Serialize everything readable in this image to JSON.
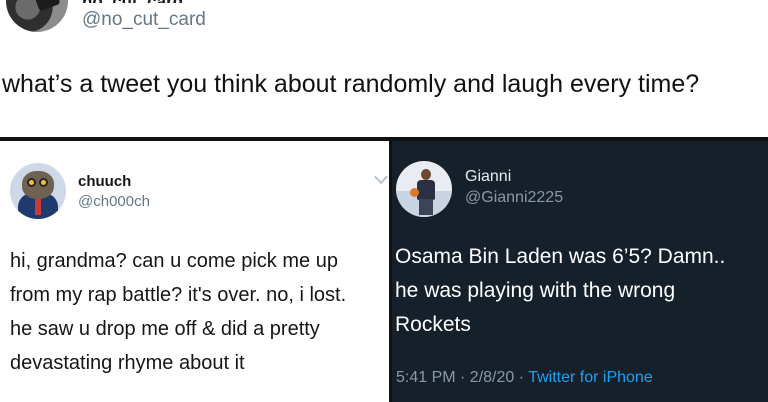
{
  "top_tweet": {
    "name": "no_cut_card",
    "handle": "@no_cut_card",
    "text": "what’s a tweet you think about randomly and laugh every time?"
  },
  "left_tweet": {
    "name": "chuuch",
    "handle": "@ch000ch",
    "lines": [
      "hi, grandma? can u come pick me up",
      "from my rap battle? it's over. no, i lost.",
      "he saw u drop me off & did a pretty",
      "devastating rhyme about it"
    ]
  },
  "right_tweet": {
    "name": "Gianni",
    "handle": "@Gianni2225",
    "lines": [
      "Osama Bin Laden was 6’5? Damn..",
      "he was playing with the wrong",
      "Rockets"
    ],
    "time": "5:41 PM · 2/8/20 · ",
    "source": "Twitter for iPhone"
  },
  "colors": {
    "dark_background": "#15202b",
    "link_blue": "#1da1f2",
    "handle_gray": "#657786"
  },
  "icons": {
    "left_menu": "chevron-down-icon"
  }
}
